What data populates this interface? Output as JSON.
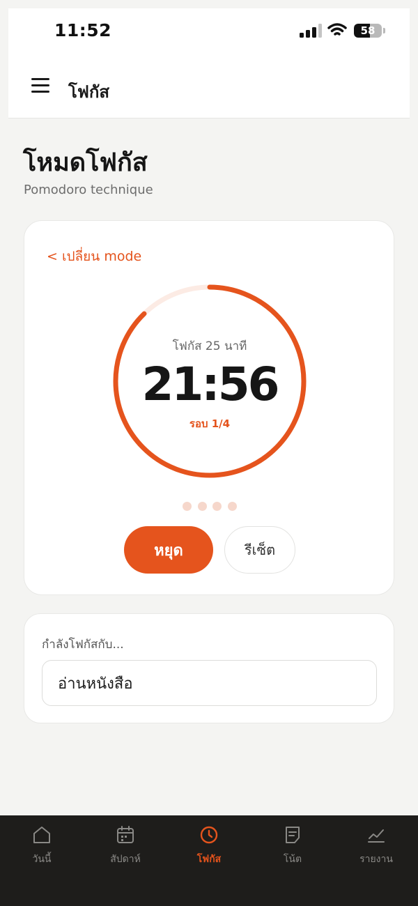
{
  "status_bar": {
    "time": "11:52",
    "battery": "58"
  },
  "app_bar": {
    "title": "โฟกัส"
  },
  "page": {
    "title": "โหมดโฟกัส",
    "subtitle": "Pomodoro technique"
  },
  "timer": {
    "switch_mode": "< เปลี่ยน mode",
    "label": "โฟกัส 25 นาที",
    "time_remaining": "21:56",
    "round": "รอบ 1/4",
    "progress_fraction": 0.877,
    "total_sessions": 4,
    "pause_label": "หยุด",
    "reset_label": "รีเซ็ต"
  },
  "task": {
    "label": "กำลังโฟกัสกับ...",
    "value": "อ่านหนังสือ"
  },
  "tabs": [
    {
      "label": "วันนี้",
      "icon": "home-icon"
    },
    {
      "label": "สัปดาห์",
      "icon": "calendar-icon"
    },
    {
      "label": "โฟกัส",
      "icon": "clock-icon",
      "active": true
    },
    {
      "label": "โน้ต",
      "icon": "note-icon"
    },
    {
      "label": "รายงาน",
      "icon": "chart-icon"
    }
  ],
  "colors": {
    "accent": "#e5541d",
    "ring_track": "#fcebe4",
    "dot": "#f6d7cb",
    "tabbar": "#1e1d1b"
  }
}
